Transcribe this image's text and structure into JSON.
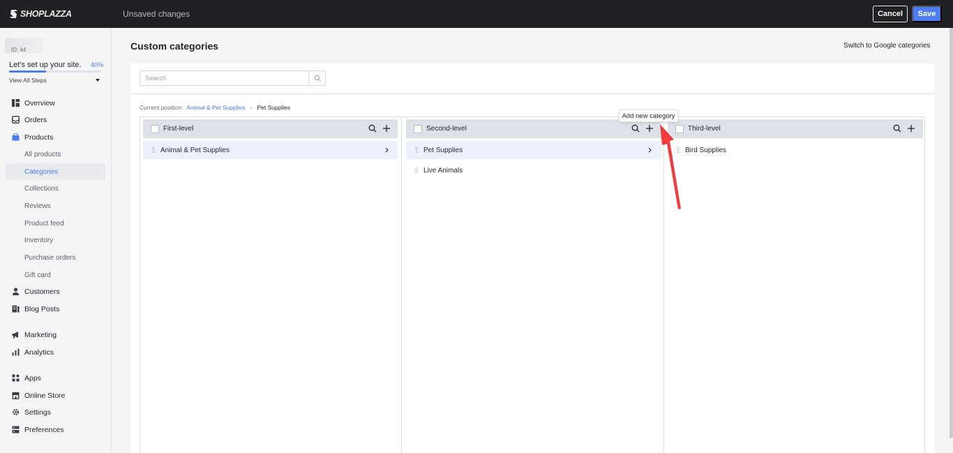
{
  "topbar": {
    "logo_text": "SHOPLAZZA",
    "status": "Unsaved changes",
    "cancel_label": "Cancel",
    "save_label": "Save",
    "accent_color": "#4c7cf0"
  },
  "sidebar": {
    "store_id": "ID: 44",
    "setup": {
      "label": "Let's set up your site.",
      "percent_text": "40%",
      "progress_fraction": 0.4,
      "view_steps": "View All Steps"
    },
    "items": [
      {
        "label": "Overview",
        "icon": "overview-icon"
      },
      {
        "label": "Orders",
        "icon": "orders-icon"
      },
      {
        "label": "Products",
        "icon": "products-icon"
      },
      {
        "label": "All products"
      },
      {
        "label": "Categories"
      },
      {
        "label": "Collections"
      },
      {
        "label": "Reviews"
      },
      {
        "label": "Product feed"
      },
      {
        "label": "Inventory"
      },
      {
        "label": "Purchase orders"
      },
      {
        "label": "Gift card"
      },
      {
        "label": "Customers",
        "icon": "customers-icon"
      },
      {
        "label": "Blog Posts",
        "icon": "blog-posts-icon"
      },
      {
        "label": "Marketing",
        "icon": "marketing-icon"
      },
      {
        "label": "Analytics",
        "icon": "analytics-icon"
      },
      {
        "label": "Apps",
        "icon": "apps-icon"
      },
      {
        "label": "Online Store",
        "icon": "online-store-icon"
      },
      {
        "label": "Settings",
        "icon": "settings-icon"
      },
      {
        "label": "Preferences",
        "icon": "preferences-icon"
      }
    ]
  },
  "main": {
    "title": "Custom categories",
    "switch_link": "Switch to Google categories",
    "search": {
      "placeholder": "Search",
      "value": ""
    },
    "breadcrumb": {
      "prefix": "Current position:",
      "link": "Animal & Pet Supplies",
      "current": "Pet Supplies"
    },
    "columns": [
      {
        "title": "First-level",
        "items": [
          {
            "label": "Animal & Pet Supplies",
            "selected": true,
            "has_children": true
          }
        ]
      },
      {
        "title": "Second-level",
        "items": [
          {
            "label": "Pet Supplies",
            "selected": true,
            "has_children": true
          },
          {
            "label": "Live Animals",
            "selected": false,
            "has_children": false
          }
        ]
      },
      {
        "title": "Third-level",
        "items": [
          {
            "label": "Bird Supplies",
            "selected": false,
            "has_children": false
          }
        ]
      }
    ],
    "tooltip": "Add new category"
  }
}
